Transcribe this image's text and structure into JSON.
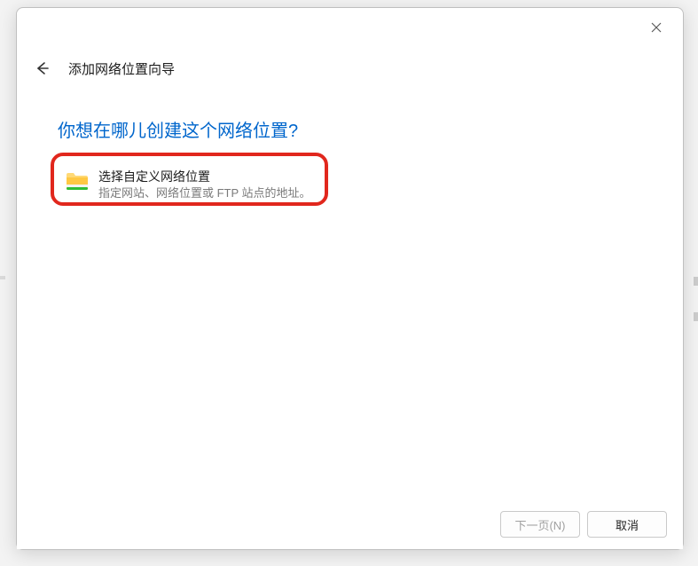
{
  "wizard": {
    "title": "添加网络位置向导",
    "heading": "你想在哪儿创建这个网络位置?"
  },
  "option": {
    "title": "选择自定义网络位置",
    "description": "指定网站、网络位置或 FTP 站点的地址。"
  },
  "buttons": {
    "next": "下一页(N)",
    "cancel": "取消"
  }
}
